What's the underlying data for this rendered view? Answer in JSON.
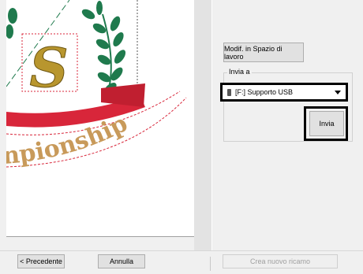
{
  "buttons": {
    "modify_label": "Modif. in Spazio di lavoro",
    "send_label": "Invia",
    "back_label": "< Precedente",
    "cancel_label": "Annulla",
    "create_new_label": "Crea nuovo ricamo"
  },
  "send_to": {
    "group_label": "Invia a",
    "selected_destination": "[F:] Supporto USB"
  },
  "preview": {
    "monogram_letter": "S",
    "arc_text": "npionship"
  },
  "colors": {
    "gold": "#b8962e",
    "green": "#1f7a4d",
    "ribbon_red": "#d8263a"
  }
}
